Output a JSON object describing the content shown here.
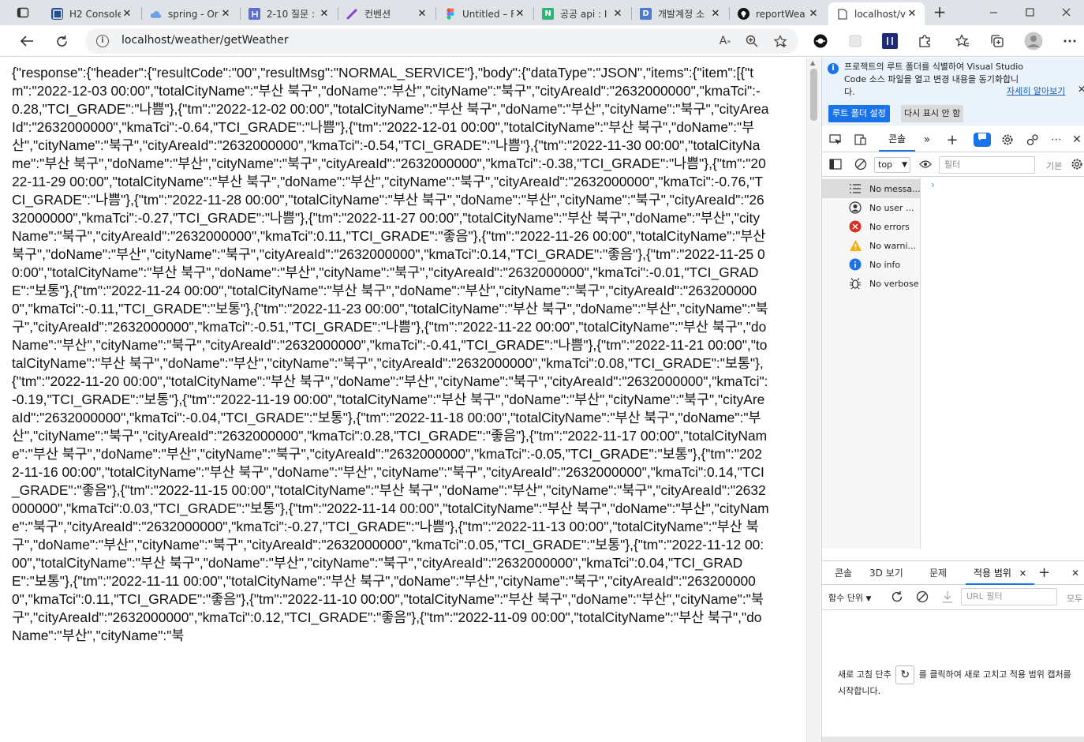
{
  "tabs": [
    {
      "title": "H2 Console",
      "favicon": "h2-icon",
      "color": "#1f4f8f"
    },
    {
      "title": "spring - Or",
      "favicon": "cloud-icon",
      "color": "#6aa0e8"
    },
    {
      "title": "2-10 질문 :",
      "favicon": "doc-icon",
      "color": "#5b6fd6"
    },
    {
      "title": "컨벤션",
      "favicon": "pen-icon",
      "color": "#8b3fd9"
    },
    {
      "title": "Untitled – F",
      "favicon": "figma-icon",
      "color": "#f24e1e"
    },
    {
      "title": "공공 api : I",
      "favicon": "notion-n-icon",
      "color": "#2bb673"
    },
    {
      "title": "개발계정 소",
      "favicon": "d-icon",
      "color": "#4a7bd0"
    },
    {
      "title": "reportWea",
      "favicon": "github-icon",
      "color": "#111111"
    },
    {
      "title": "localhost/v",
      "favicon": "page-icon",
      "color": "#555555"
    }
  ],
  "address_bar": {
    "url": "localhost/weather/getWeather"
  },
  "page": {
    "json_text": "{\"response\":{\"header\":{\"resultCode\":\"00\",\"resultMsg\":\"NORMAL_SERVICE\"},\"body\":{\"dataType\":\"JSON\",\"items\":{\"item\":[{\"tm\":\"2022-12-03 00:00\",\"totalCityName\":\"부산 북구\",\"doName\":\"부산\",\"cityName\":\"북구\",\"cityAreaId\":\"2632000000\",\"kmaTci\":-0.28,\"TCI_GRADE\":\"나쁨\"},{\"tm\":\"2022-12-02 00:00\",\"totalCityName\":\"부산 북구\",\"doName\":\"부산\",\"cityName\":\"북구\",\"cityAreaId\":\"2632000000\",\"kmaTci\":-0.64,\"TCI_GRADE\":\"나쁨\"},{\"tm\":\"2022-12-01 00:00\",\"totalCityName\":\"부산 북구\",\"doName\":\"부산\",\"cityName\":\"북구\",\"cityAreaId\":\"2632000000\",\"kmaTci\":-0.54,\"TCI_GRADE\":\"나쁨\"},{\"tm\":\"2022-11-30 00:00\",\"totalCityName\":\"부산 북구\",\"doName\":\"부산\",\"cityName\":\"북구\",\"cityAreaId\":\"2632000000\",\"kmaTci\":-0.38,\"TCI_GRADE\":\"나쁨\"},{\"tm\":\"2022-11-29 00:00\",\"totalCityName\":\"부산 북구\",\"doName\":\"부산\",\"cityName\":\"북구\",\"cityAreaId\":\"2632000000\",\"kmaTci\":-0.76,\"TCI_GRADE\":\"나쁨\"},{\"tm\":\"2022-11-28 00:00\",\"totalCityName\":\"부산 북구\",\"doName\":\"부산\",\"cityName\":\"북구\",\"cityAreaId\":\"2632000000\",\"kmaTci\":-0.27,\"TCI_GRADE\":\"나쁨\"},{\"tm\":\"2022-11-27 00:00\",\"totalCityName\":\"부산 북구\",\"doName\":\"부산\",\"cityName\":\"북구\",\"cityAreaId\":\"2632000000\",\"kmaTci\":0.11,\"TCI_GRADE\":\"좋음\"},{\"tm\":\"2022-11-26 00:00\",\"totalCityName\":\"부산 북구\",\"doName\":\"부산\",\"cityName\":\"북구\",\"cityAreaId\":\"2632000000\",\"kmaTci\":0.14,\"TCI_GRADE\":\"좋음\"},{\"tm\":\"2022-11-25 00:00\",\"totalCityName\":\"부산 북구\",\"doName\":\"부산\",\"cityName\":\"북구\",\"cityAreaId\":\"2632000000\",\"kmaTci\":-0.01,\"TCI_GRADE\":\"보통\"},{\"tm\":\"2022-11-24 00:00\",\"totalCityName\":\"부산 북구\",\"doName\":\"부산\",\"cityName\":\"북구\",\"cityAreaId\":\"2632000000\",\"kmaTci\":-0.11,\"TCI_GRADE\":\"보통\"},{\"tm\":\"2022-11-23 00:00\",\"totalCityName\":\"부산 북구\",\"doName\":\"부산\",\"cityName\":\"북구\",\"cityAreaId\":\"2632000000\",\"kmaTci\":-0.51,\"TCI_GRADE\":\"나쁨\"},{\"tm\":\"2022-11-22 00:00\",\"totalCityName\":\"부산 북구\",\"doName\":\"부산\",\"cityName\":\"북구\",\"cityAreaId\":\"2632000000\",\"kmaTci\":-0.41,\"TCI_GRADE\":\"나쁨\"},{\"tm\":\"2022-11-21 00:00\",\"totalCityName\":\"부산 북구\",\"doName\":\"부산\",\"cityName\":\"북구\",\"cityAreaId\":\"2632000000\",\"kmaTci\":0.08,\"TCI_GRADE\":\"보통\"},{\"tm\":\"2022-11-20 00:00\",\"totalCityName\":\"부산 북구\",\"doName\":\"부산\",\"cityName\":\"북구\",\"cityAreaId\":\"2632000000\",\"kmaTci\":-0.19,\"TCI_GRADE\":\"보통\"},{\"tm\":\"2022-11-19 00:00\",\"totalCityName\":\"부산 북구\",\"doName\":\"부산\",\"cityName\":\"북구\",\"cityAreaId\":\"2632000000\",\"kmaTci\":-0.04,\"TCI_GRADE\":\"보통\"},{\"tm\":\"2022-11-18 00:00\",\"totalCityName\":\"부산 북구\",\"doName\":\"부산\",\"cityName\":\"북구\",\"cityAreaId\":\"2632000000\",\"kmaTci\":0.28,\"TCI_GRADE\":\"좋음\"},{\"tm\":\"2022-11-17 00:00\",\"totalCityName\":\"부산 북구\",\"doName\":\"부산\",\"cityName\":\"북구\",\"cityAreaId\":\"2632000000\",\"kmaTci\":-0.05,\"TCI_GRADE\":\"보통\"},{\"tm\":\"2022-11-16 00:00\",\"totalCityName\":\"부산 북구\",\"doName\":\"부산\",\"cityName\":\"북구\",\"cityAreaId\":\"2632000000\",\"kmaTci\":0.14,\"TCI_GRADE\":\"좋음\"},{\"tm\":\"2022-11-15 00:00\",\"totalCityName\":\"부산 북구\",\"doName\":\"부산\",\"cityName\":\"북구\",\"cityAreaId\":\"2632000000\",\"kmaTci\":0.03,\"TCI_GRADE\":\"보통\"},{\"tm\":\"2022-11-14 00:00\",\"totalCityName\":\"부산 북구\",\"doName\":\"부산\",\"cityName\":\"북구\",\"cityAreaId\":\"2632000000\",\"kmaTci\":-0.27,\"TCI_GRADE\":\"나쁨\"},{\"tm\":\"2022-11-13 00:00\",\"totalCityName\":\"부산 북구\",\"doName\":\"부산\",\"cityName\":\"북구\",\"cityAreaId\":\"2632000000\",\"kmaTci\":0.05,\"TCI_GRADE\":\"보통\"},{\"tm\":\"2022-11-12 00:00\",\"totalCityName\":\"부산 북구\",\"doName\":\"부산\",\"cityName\":\"북구\",\"cityAreaId\":\"2632000000\",\"kmaTci\":0.04,\"TCI_GRADE\":\"보통\"},{\"tm\":\"2022-11-11 00:00\",\"totalCityName\":\"부산 북구\",\"doName\":\"부산\",\"cityName\":\"북구\",\"cityAreaId\":\"2632000000\",\"kmaTci\":0.11,\"TCI_GRADE\":\"좋음\"},{\"tm\":\"2022-11-10 00:00\",\"totalCityName\":\"부산 북구\",\"doName\":\"부산\",\"cityName\":\"북구\",\"cityAreaId\":\"2632000000\",\"kmaTci\":0.12,\"TCI_GRADE\":\"좋음\"},{\"tm\":\"2022-11-09 00:00\",\"totalCityName\":\"부산 북구\",\"doName\":\"부산\",\"cityName\":\"북"
  },
  "devtools": {
    "banner": {
      "message": "프로젝트의 루트 폴더를 식별하여 Visual Studio Code 소스 파일을 열고 변경 내용을 동기화합니다.",
      "learn_more": "자세히 알아보기",
      "primary_button": "루트 폴더 설정",
      "secondary_button": "다시 표시 안 함"
    },
    "active_tab": "콘솔",
    "context": "top",
    "filter_placeholder": "필터",
    "level_label": "기본",
    "sidebar": [
      {
        "label": "No messa...",
        "icon": "list-icon",
        "color": "#333333"
      },
      {
        "label": "No user ...",
        "icon": "user-icon",
        "color": "#333333"
      },
      {
        "label": "No errors",
        "icon": "error-icon",
        "color": "#d93025"
      },
      {
        "label": "No warni...",
        "icon": "warning-icon",
        "color": "#f2b20c"
      },
      {
        "label": "No info",
        "icon": "info-icon",
        "color": "#1a73e8"
      },
      {
        "label": "No verbose",
        "icon": "bug-icon",
        "color": "#333333"
      }
    ],
    "drawer": {
      "tabs": [
        "콘솔",
        "3D 보기",
        "문제",
        "적용 범위"
      ],
      "scope_select": "함수 단위",
      "url_filter_placeholder": "URL 필터",
      "all_label": "모두",
      "message_before": "새로 고침 단추",
      "message_after": "를 클릭하여 새로 고치고 적용 범위 캡처를 시작합니다."
    }
  },
  "colors": {
    "accent": "#1a73e8",
    "tabstrip": "#dfe3e8"
  }
}
